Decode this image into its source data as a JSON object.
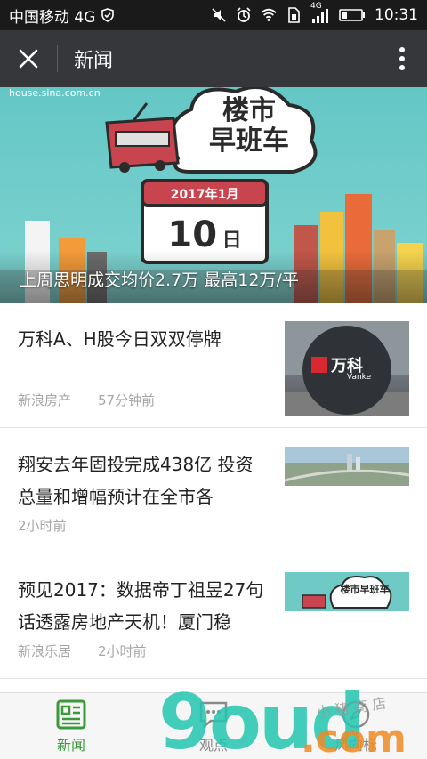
{
  "status_bar": {
    "carrier": "中国移动 4G",
    "network": "4G",
    "time": "10:31"
  },
  "app_bar": {
    "title": "新闻"
  },
  "banner": {
    "source_text": "house.sina.com.cn",
    "sign_line1": "楼市",
    "sign_line2": "早班车",
    "calendar_month": "2017年1月",
    "calendar_day": "10",
    "calendar_day_unit": "日",
    "caption": "上周思明成交均价2.7万 最高12万/平"
  },
  "news": [
    {
      "title": "万科A、H股今日双双停牌",
      "source": "新浪房产",
      "time": "57分钟前",
      "thumb_text": "万科",
      "thumb_sub": "Vanke"
    },
    {
      "title": "翔安去年固投完成438亿 投资总量和增幅预计在全市各",
      "source": "",
      "time": "2小时前"
    },
    {
      "title": "预见2017：数据帝丁祖昱27句话透露房地产天机！厦门稳",
      "source": "新浪乐居",
      "time": "2小时前",
      "thumb_text": "楼市早班车"
    }
  ],
  "bottom_nav": [
    {
      "label": "新闻",
      "icon": "news-icon",
      "active": true
    },
    {
      "label": "观点",
      "icon": "chat-icon",
      "active": false
    },
    {
      "label": "风向标",
      "icon": "compass-icon",
      "active": false
    }
  ],
  "watermark": {
    "main": "9oud",
    "domain": ".com",
    "signature": "小 猪 商 店"
  },
  "colors": {
    "status_bar": "#1a1a1a",
    "app_bar": "#35373b",
    "active_tab": "#3a9a3a",
    "meta_text": "#a6a6a6"
  }
}
